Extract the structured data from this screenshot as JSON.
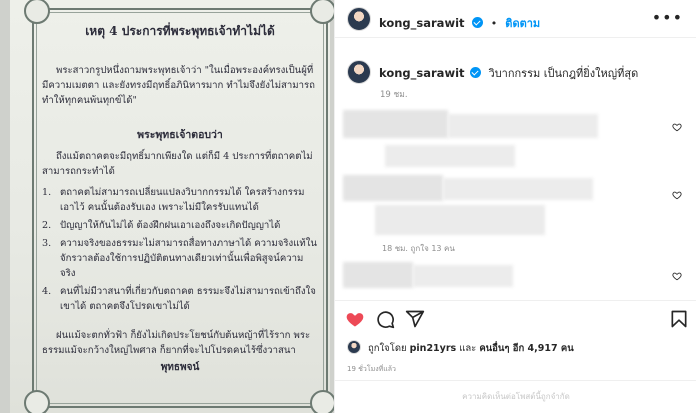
{
  "document": {
    "title": "เหตุ 4 ประการที่พระพุทธเจ้าทำไม่ได้",
    "intro": "พระสาวกรูปหนึ่งถามพระพุทธเจ้าว่า \"ในเมื่อพระองค์ทรงเป็นผู้ที่มีความเมตตา และยังทรงมีฤทธิ์อภินิหารมาก ทำไมจึงยังไม่สามารถทำให้ทุกคนพ้นทุกข์ได้\"",
    "answer_heading": "พระพุทธเจ้าตอบว่า",
    "answer_intro": "ถึงแม้ตถาคตจะมีฤทธิ์มากเพียงใด แต่ก็มี 4 ประการที่ตถาคตไม่สามารถกระทำได้",
    "items": [
      {
        "num": "1.",
        "text": "ตถาคตไม่สามารถเปลี่ยนแปลงวิบากกรรมได้ ใครสร้างกรรมเอาไว้ คนนั้นต้องรับเอง เพราะไม่มีใครรับแทนได้"
      },
      {
        "num": "2.",
        "text": "ปัญญาให้กันไม่ได้ ต้องฝึกฝนเอาเองถึงจะเกิดปัญญาได้"
      },
      {
        "num": "3.",
        "text": "ความจริงของธรรมะไม่สามารถสื่อทางภาษาได้ ความจริงแท้ในจักรวาลต้องใช้การปฏิบัติตนทางเดียวเท่านั้นเพื่อพิสูจน์ความจริง"
      },
      {
        "num": "4.",
        "text": "คนที่ไม่มีวาสนาที่เกี่ยวกับตถาคต ธรรมะจึงไม่สามารถเข้าถึงใจเขาได้ ตถาคตจึงโปรดเขาไม่ได้"
      }
    ],
    "closing": "ฝนแม้จะตกทั่วฟ้า ก็ยังไม่เกิดประโยชน์กับต้นหญ้าที่ไร้ราก พระธรรมแม้จะกว้างใหญ่ไพศาล ก็ยากที่จะไปโปรดคนไร้ซึ่งวาสนา",
    "signature": "พุทธพจน์"
  },
  "post": {
    "username": "kong_sarawit",
    "follow_label": "ติดตาม",
    "more_label": "•••",
    "caption": "วิบากกรรม เป็นกฎที่ยิ่งใหญ่ที่สุด",
    "caption_time": "19 ชม.",
    "comment_meta": "18 ชม.  ถูกใจ 13 คน",
    "liked_by_prefix": "ถูกใจโดย",
    "liked_by_user": "pin21yrs",
    "liked_by_mid": "และ",
    "liked_by_others": "คนอื่นๆ อีก 4,917 คน",
    "timestamp": "19 ชั่วโมงที่แล้ว",
    "footer_note": "ความคิดเห็นต่อโพสต์นี้ถูกจำกัด"
  },
  "colors": {
    "accent": "#0095f6",
    "like": "#ed4956",
    "text": "#262626",
    "muted": "#8e8e8e"
  },
  "icons": [
    "verified-badge-icon",
    "more-options-icon",
    "heart-icon",
    "comment-icon",
    "share-icon",
    "bookmark-icon"
  ]
}
